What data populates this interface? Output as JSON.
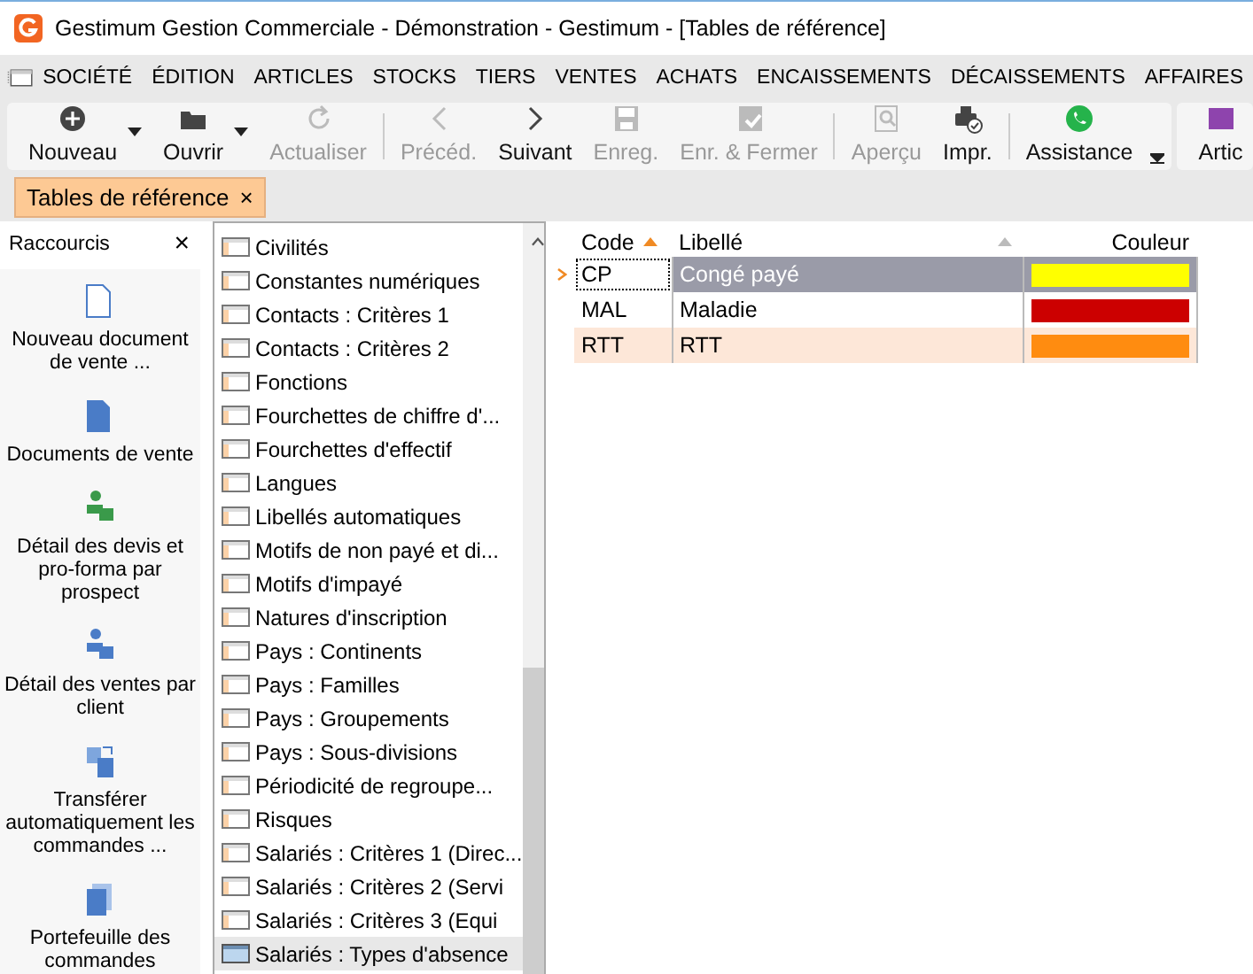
{
  "window": {
    "title": "Gestimum Gestion Commerciale - Démonstration - Gestimum - [Tables de référence]"
  },
  "menu": [
    "SOCIÉTÉ",
    "ÉDITION",
    "ARTICLES",
    "STOCKS",
    "TIERS",
    "VENTES",
    "ACHATS",
    "ENCAISSEMENTS",
    "DÉCAISSEMENTS",
    "AFFAIRES"
  ],
  "toolbar": [
    {
      "label": "Nouveau",
      "disabled": false,
      "dropdown": true
    },
    {
      "label": "Ouvrir",
      "disabled": false,
      "dropdown": true
    },
    {
      "label": "Actualiser",
      "disabled": true,
      "dropdown": false
    },
    {
      "label": "Précéd.",
      "disabled": true,
      "dropdown": false
    },
    {
      "label": "Suivant",
      "disabled": false,
      "dropdown": false
    },
    {
      "label": "Enreg.",
      "disabled": true,
      "dropdown": false
    },
    {
      "label": "Enr. & Fermer",
      "disabled": true,
      "dropdown": false
    },
    {
      "label": "Aperçu",
      "disabled": true,
      "dropdown": false
    },
    {
      "label": "Impr.",
      "disabled": false,
      "dropdown": false
    },
    {
      "label": "Assistance",
      "disabled": false,
      "dropdown": false
    },
    {
      "label": "Artic",
      "disabled": false,
      "dropdown": false
    }
  ],
  "tabs": [
    {
      "label": "Tables de référence",
      "selected": true,
      "close": "×"
    }
  ],
  "shortcuts": {
    "title": "Raccourcis",
    "close": "×",
    "items": [
      "Nouveau document de vente ...",
      "Documents de vente",
      "Détail des devis et pro-forma par prospect",
      "Détail des ventes par client",
      "Transférer automatiquement les commandes ...",
      "Portefeuille des commandes"
    ]
  },
  "tables": [
    {
      "label": "Civilités",
      "selected": false
    },
    {
      "label": "Constantes numériques",
      "selected": false
    },
    {
      "label": "Contacts : Critères 1",
      "selected": false
    },
    {
      "label": "Contacts : Critères 2",
      "selected": false
    },
    {
      "label": "Fonctions",
      "selected": false
    },
    {
      "label": "Fourchettes de chiffre d'...",
      "selected": false
    },
    {
      "label": "Fourchettes d'effectif",
      "selected": false
    },
    {
      "label": "Langues",
      "selected": false
    },
    {
      "label": "Libellés automatiques",
      "selected": false
    },
    {
      "label": "Motifs de non payé et di...",
      "selected": false
    },
    {
      "label": "Motifs d'impayé",
      "selected": false
    },
    {
      "label": "Natures d'inscription",
      "selected": false
    },
    {
      "label": "Pays : Continents",
      "selected": false
    },
    {
      "label": "Pays : Familles",
      "selected": false
    },
    {
      "label": "Pays : Groupements",
      "selected": false
    },
    {
      "label": "Pays : Sous-divisions",
      "selected": false
    },
    {
      "label": "Périodicité de regroupe...",
      "selected": false
    },
    {
      "label": "Risques",
      "selected": false
    },
    {
      "label": "Salariés : Critères 1 (Direc...",
      "selected": false
    },
    {
      "label": "Salariés : Critères 2 (Servi",
      "selected": false
    },
    {
      "label": "Salariés : Critères 3 (Equi",
      "selected": false
    },
    {
      "label": "Salariés : Types d'absence",
      "selected": true
    }
  ],
  "grid": {
    "columns": [
      "Code",
      "Libellé",
      "Couleur"
    ],
    "rows": [
      {
        "code": "CP",
        "label": "Congé payé",
        "color": "#ffff00",
        "selected": true
      },
      {
        "code": "MAL",
        "label": "Maladie",
        "color": "#cc0000",
        "selected": false
      },
      {
        "code": "RTT",
        "label": "RTT",
        "color": "#ff8c10",
        "selected": false
      }
    ]
  }
}
